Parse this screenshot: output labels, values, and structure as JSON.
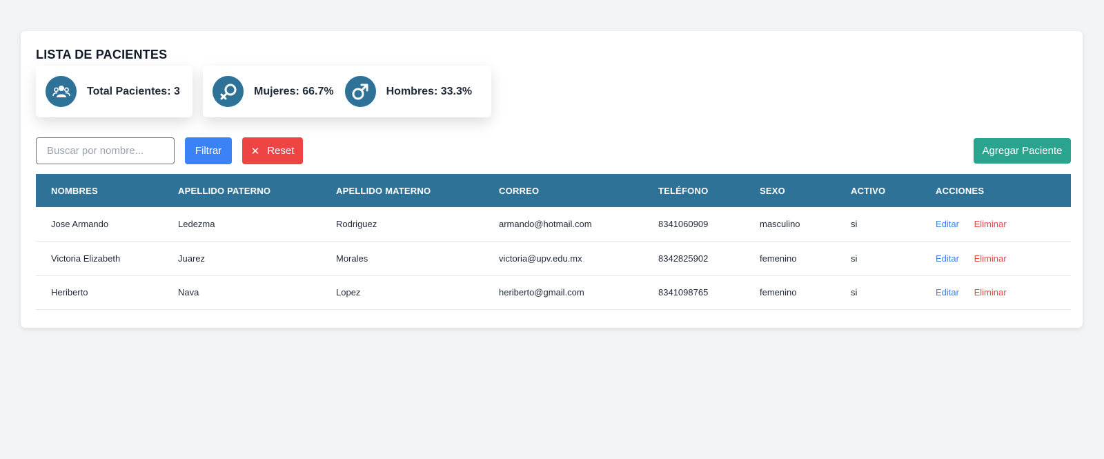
{
  "header": {
    "title": "LISTA DE PACIENTES"
  },
  "stats": {
    "total": {
      "label": "Total Pacientes: 3",
      "icon": "users-icon"
    },
    "women": {
      "label": "Mujeres: 66.7%",
      "icon": "female-icon",
      "percent": 66.7
    },
    "men": {
      "label": "Hombres: 33.3%",
      "icon": "male-icon",
      "percent": 33.3
    }
  },
  "toolbar": {
    "search_placeholder": "Buscar por nombre...",
    "search_value": "",
    "filter_label": "Filtrar",
    "reset_label": "Reset",
    "reset_icon": "close-icon",
    "add_label": "Agregar Paciente"
  },
  "table": {
    "columns": [
      "NOMBRES",
      "APELLIDO PATERNO",
      "APELLIDO MATERNO",
      "CORREO",
      "TELÉFONO",
      "SEXO",
      "ACTIVO",
      "ACCIONES"
    ],
    "rows": [
      {
        "nombres": "Jose Armando",
        "paterno": "Ledezma",
        "materno": "Rodriguez",
        "correo": "armando@hotmail.com",
        "telefono": "8341060909",
        "sexo": "masculino",
        "activo": "si",
        "edit": "Editar",
        "delete": "Eliminar"
      },
      {
        "nombres": "Victoria Elizabeth",
        "paterno": "Juarez",
        "materno": "Morales",
        "correo": "victoria@upv.edu.mx",
        "telefono": "8342825902",
        "sexo": "femenino",
        "activo": "si",
        "edit": "Editar",
        "delete": "Eliminar"
      },
      {
        "nombres": "Heriberto",
        "paterno": "Nava",
        "materno": "Lopez",
        "correo": "heriberto@gmail.com",
        "telefono": "8341098765",
        "sexo": "femenino",
        "activo": "si",
        "edit": "Editar",
        "delete": "Eliminar"
      }
    ]
  },
  "colors": {
    "accent": "#2e7298",
    "filter": "#3b82f6",
    "reset": "#ef4444",
    "add": "#2aa48f"
  }
}
